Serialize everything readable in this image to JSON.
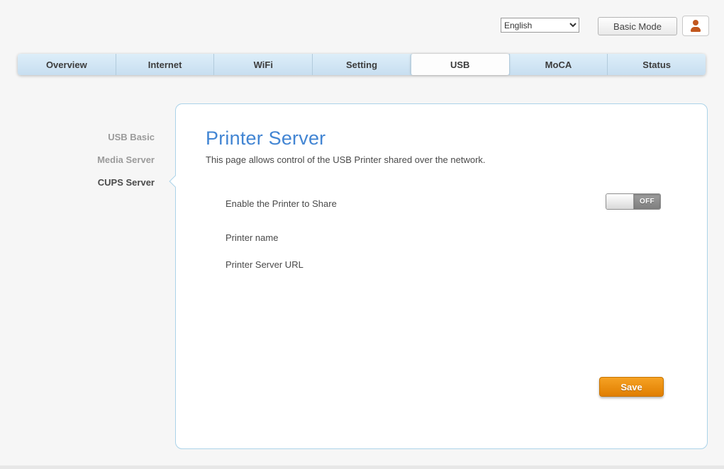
{
  "header": {
    "language_select": {
      "value": "English"
    },
    "mode_button_label": "Basic Mode"
  },
  "tabs": [
    {
      "label": "Overview",
      "active": false
    },
    {
      "label": "Internet",
      "active": false
    },
    {
      "label": "WiFi",
      "active": false
    },
    {
      "label": "Setting",
      "active": false
    },
    {
      "label": "USB",
      "active": true
    },
    {
      "label": "MoCA",
      "active": false
    },
    {
      "label": "Status",
      "active": false
    }
  ],
  "sidebar": {
    "items": [
      {
        "label": "USB Basic",
        "active": false
      },
      {
        "label": "Media Server",
        "active": false
      },
      {
        "label": "CUPS Server",
        "active": true
      }
    ]
  },
  "main": {
    "title": "Printer Server",
    "description": "This page allows control of the USB Printer shared over the network.",
    "fields": [
      {
        "label": "Enable the Printer to Share",
        "type": "toggle",
        "value": "OFF"
      },
      {
        "label": "Printer name",
        "type": "text",
        "value": ""
      },
      {
        "label": "Printer Server URL",
        "type": "text",
        "value": ""
      }
    ],
    "save_button_label": "Save"
  },
  "colors": {
    "title_blue": "#4285d3",
    "tab_bar_blue": "#cfe3f2",
    "panel_border_blue": "#abd3e9",
    "save_orange": "#e8860d",
    "toggle_off_gray": "#8f8f8f"
  }
}
